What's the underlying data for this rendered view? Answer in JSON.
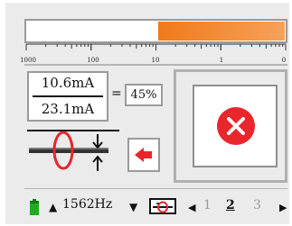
{
  "meter": {
    "fill_fraction": 0.495,
    "fill_color": "#f07a1a",
    "scale_labels": [
      "1000",
      "100",
      "10",
      "1",
      "0"
    ]
  },
  "ratio": {
    "numerator": "10.6mA",
    "denominator": "23.1mA",
    "equals": "=",
    "percent": "45%"
  },
  "icons": {
    "clamp": "current-clamp-icon",
    "direction": "left-arrow-icon",
    "status": "error-x-icon",
    "battery": "battery-icon",
    "probe": "probe-icon"
  },
  "colors": {
    "error": "#e8262b",
    "clamp_ring": "#e8262b",
    "battery": "#22aa22",
    "accent": "#f07a1a"
  },
  "footer": {
    "freq_up_symbol": "▲",
    "frequency": "1562Hz",
    "freq_down_symbol": "▼",
    "page_prev_symbol": "◀",
    "page_next_symbol": "▶",
    "pages": [
      "1",
      "2",
      "3"
    ],
    "current_page": "2"
  }
}
